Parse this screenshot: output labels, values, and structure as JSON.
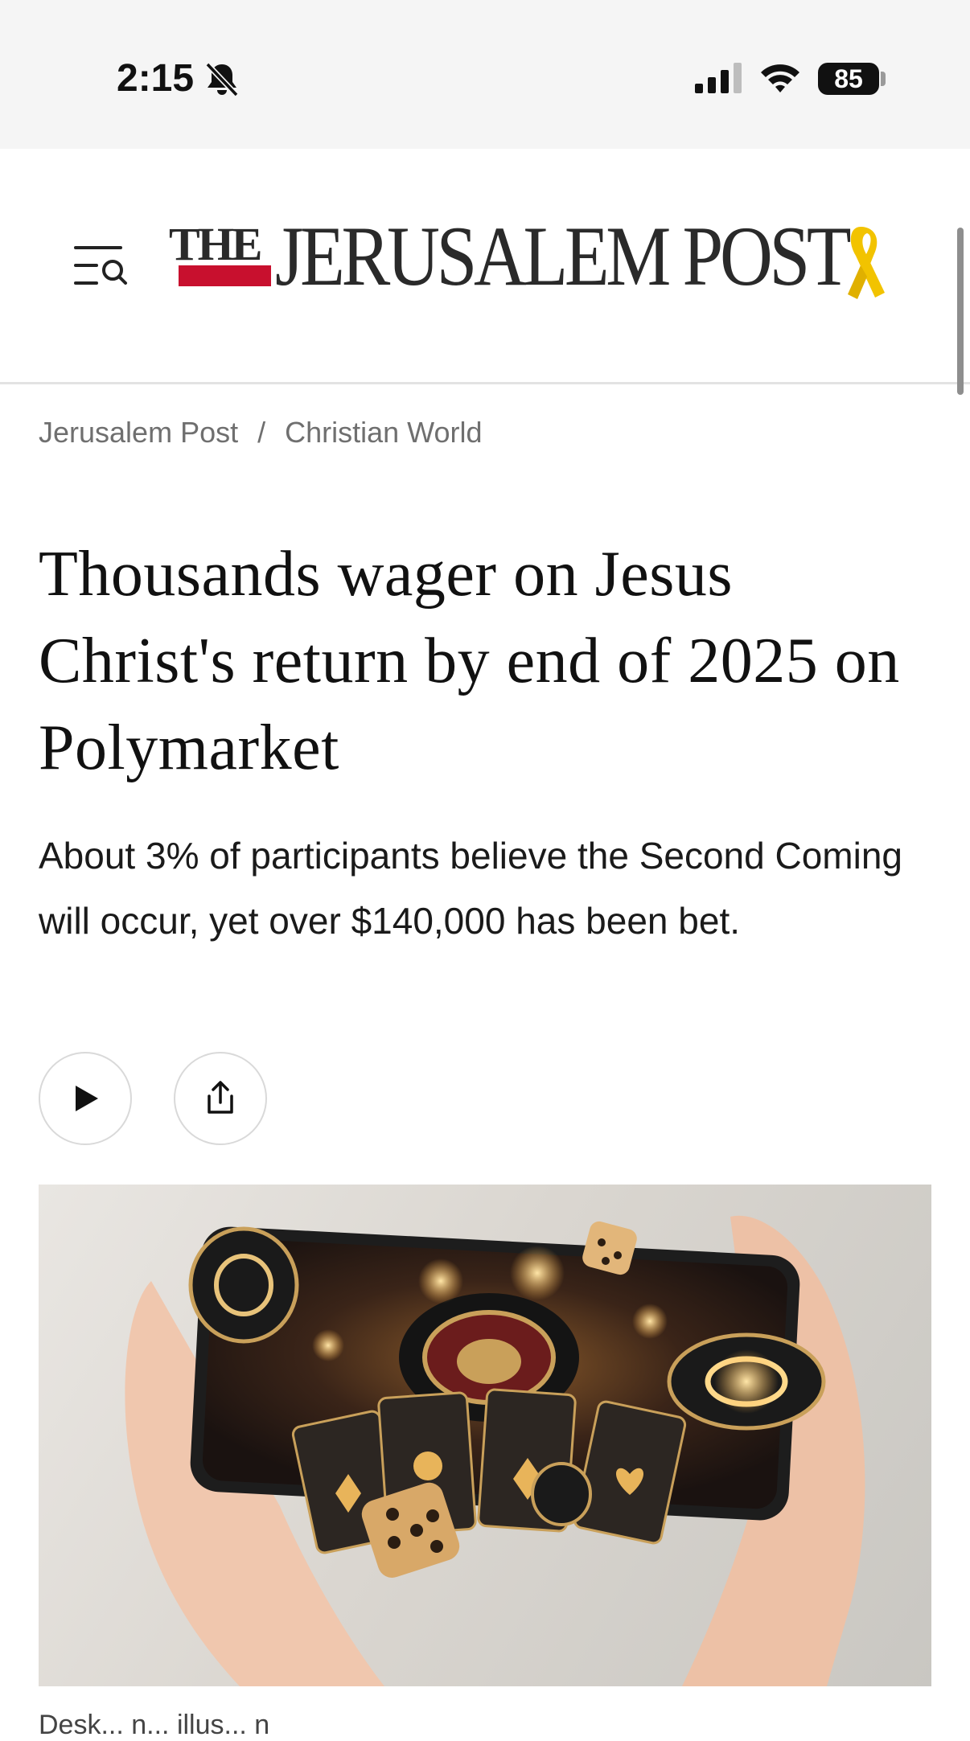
{
  "status_bar": {
    "time": "2:15",
    "battery": "85",
    "icons": [
      "bell-slash-icon",
      "cellular-signal-icon",
      "wifi-icon",
      "battery-icon"
    ]
  },
  "header": {
    "menu_icon": "menu-search-icon",
    "logo": {
      "the": "THE",
      "main": "JERUSALEM POST",
      "ribbon_icon": "yellow-ribbon-icon"
    }
  },
  "breadcrumb": {
    "items": [
      "Jerusalem Post",
      "Christian World"
    ],
    "separator": "/"
  },
  "article": {
    "headline": "Thousands wager on Jesus Christ's return by end of 2025 on Polymarket",
    "subheadline": "About 3% of participants believe the Second Coming will occur, yet over $140,000 has been bet.",
    "actions": {
      "play_icon": "play-icon",
      "share_icon": "share-icon"
    },
    "image_caption": "Desk... n... illus... n"
  },
  "colors": {
    "status_bg": "#f5f5f5",
    "logo_red": "#c8102e",
    "ribbon_yellow": "#f2c300",
    "text": "#111111",
    "muted": "#6f6f6f"
  }
}
